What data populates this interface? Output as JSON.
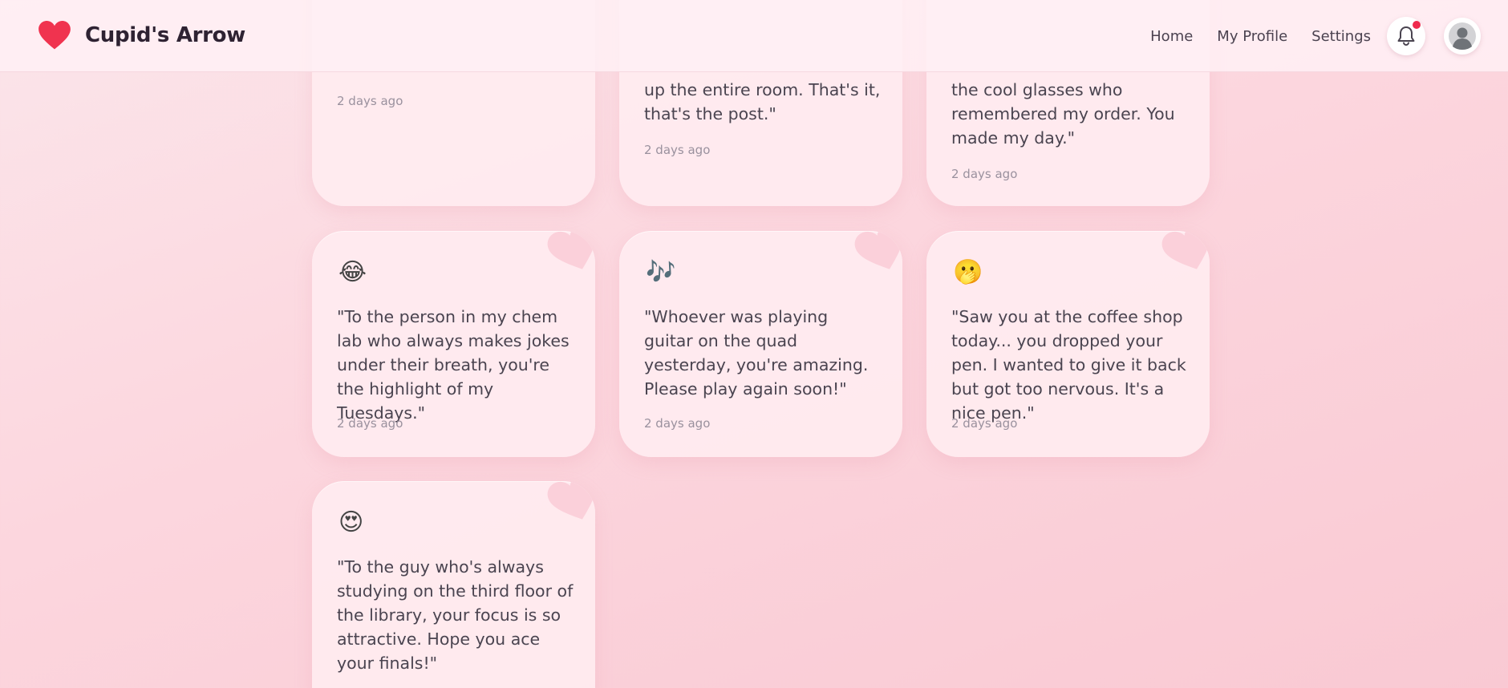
{
  "brand": {
    "name": "Cupid's Arrow",
    "icon": "heart-icon",
    "color": "#f0334f"
  },
  "nav": {
    "links": [
      "Home",
      "My Profile",
      "Settings"
    ],
    "notification_icon": "bell-icon",
    "notification_dot_color": "#ef2a4d",
    "avatar_icon": "user-avatar-icon"
  },
  "cards": [
    {
      "text": "",
      "time": "2 days ago"
    },
    {
      "text": "up the entire room. That's it, that's the post.\"",
      "time": "2 days ago"
    },
    {
      "text": "the cool glasses who remembered my order. You made my day.\"",
      "time": "2 days ago"
    },
    {
      "emoji": "😂",
      "text": "\"To the person in my chem lab who always makes jokes under their breath, you're the highlight of my Tuesdays.\"",
      "time": "2 days ago"
    },
    {
      "emoji": "🎶",
      "text": "\"Whoever was playing guitar on the quad yesterday, you're amazing. Please play again soon!\"",
      "time": "2 days ago"
    },
    {
      "emoji": "🫢",
      "text": "\"Saw you at the coffee shop today... you dropped your pen. I wanted to give it back but got too nervous. It's a nice pen.\"",
      "time": "2 days ago"
    },
    {
      "emoji": "😍",
      "text": "\"To the guy who's always studying on the third floor of the library, your focus is so attractive. Hope you ace your finals!\""
    }
  ]
}
